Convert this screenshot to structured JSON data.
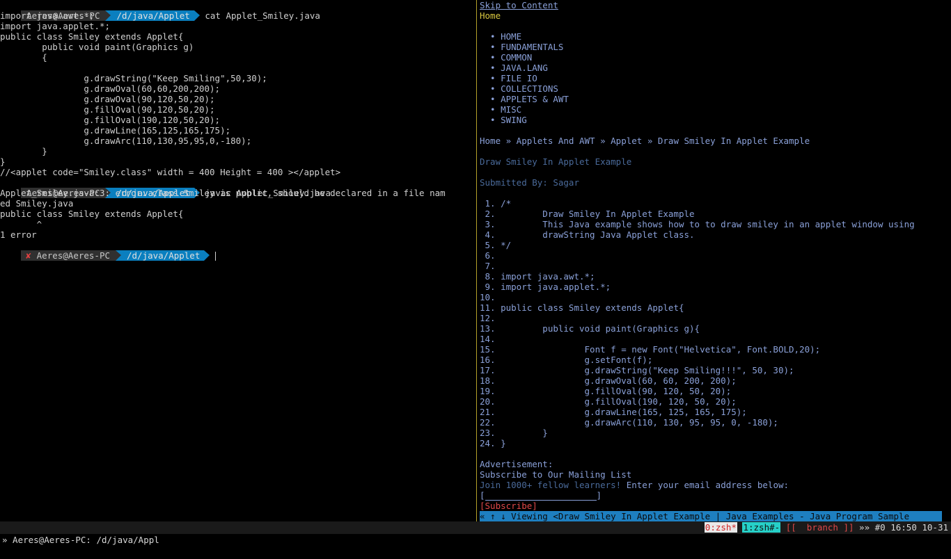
{
  "left": {
    "p1_user": "Aeres@Aeres-PC",
    "p1_path": "/d/java/Applet",
    "p1_cmd": "cat Applet_Smiley.java",
    "file_lines": [
      "import java.awt.*;",
      "import java.applet.*;",
      "public class Smiley extends Applet{",
      "        public void paint(Graphics g)",
      "        {",
      "",
      "                g.drawString(\"Keep Smiling\",50,30);",
      "                g.drawOval(60,60,200,200);",
      "                g.drawOval(90,120,50,20);",
      "                g.fillOval(90,120,50,20);",
      "                g.fillOval(190,120,50,20);",
      "                g.drawLine(165,125,165,175);",
      "                g.drawArc(110,130,95,95,0,-180);",
      "        }",
      "}",
      "//<applet code=\"Smiley.class\" width = 400 Height = 400 ></applet>"
    ],
    "p2_user": "Aeres@Aeres-PC",
    "p2_path": "/d/java/Applet",
    "p2_cmd": "javac Applet_Smiley.java",
    "error_lines": [
      "Applet_Smiley.java:3: error: class Smiley is public, should be declared in a file nam",
      "ed Smiley.java",
      "public class Smiley extends Applet{",
      "       ^",
      "1 error"
    ],
    "p3_x": "✘",
    "p3_user": "Aeres@Aeres-PC",
    "p3_path": "/d/java/Applet"
  },
  "right": {
    "skip_link": "Skip to Content",
    "home": "Home",
    "nav": [
      "HOME",
      "FUNDAMENTALS",
      "COMMON",
      "JAVA.LANG",
      "FILE IO",
      "COLLECTIONS",
      "APPLETS & AWT",
      "MISC",
      "SWING"
    ],
    "breadcrumb": "Home » Applets And AWT » Applet » Draw Smiley In Applet Example",
    "title": "Draw Smiley In Applet Example",
    "submitted": "Submitted By: Sagar",
    "code_lines": [
      " 1. /*",
      " 2.         Draw Smiley In Applet Example",
      " 3.         This Java example shows how to to draw smiley in an applet window using",
      " 4.         drawString Java Applet class.",
      " 5. */",
      " 6.",
      " 7.",
      " 8. import java.awt.*;",
      " 9. import java.applet.*;",
      "10.",
      "11. public class Smiley extends Applet{",
      "12.",
      "13.         public void paint(Graphics g){",
      "14.",
      "15.                 Font f = new Font(\"Helvetica\", Font.BOLD,20);",
      "16.                 g.setFont(f);",
      "17.                 g.drawString(\"Keep Smiling!!!\", 50, 30);",
      "18.                 g.drawOval(60, 60, 200, 200);",
      "19.                 g.fillOval(90, 120, 50, 20);",
      "20.                 g.fillOval(190, 120, 50, 20);",
      "21.                 g.drawLine(165, 125, 165, 175);",
      "22.                 g.drawArc(110, 130, 95, 95, 0, -180);",
      "23.         }",
      "24. }"
    ],
    "advert": "Advertisement:",
    "mailing": "Subscribe to Our Mailing List",
    "join": "Join 1000+ fellow learners!",
    "enter_email": " Enter your email address below:",
    "field_open": "[",
    "field_close": "]",
    "subscribe": "[Subscribe]",
    "status_line": "« ↑ ↓ Viewing <Draw Smiley In Applet Example | Java Examples - Java Program Sample"
  },
  "tmux": {
    "session": "» Aeres@Aeres-PC: /d/java/Appl",
    "win0": "0:zsh*",
    "win1": "1:zsh#-",
    "branch": " [[  branch ]]",
    "clock": " »» #0 16:50 10-31"
  }
}
